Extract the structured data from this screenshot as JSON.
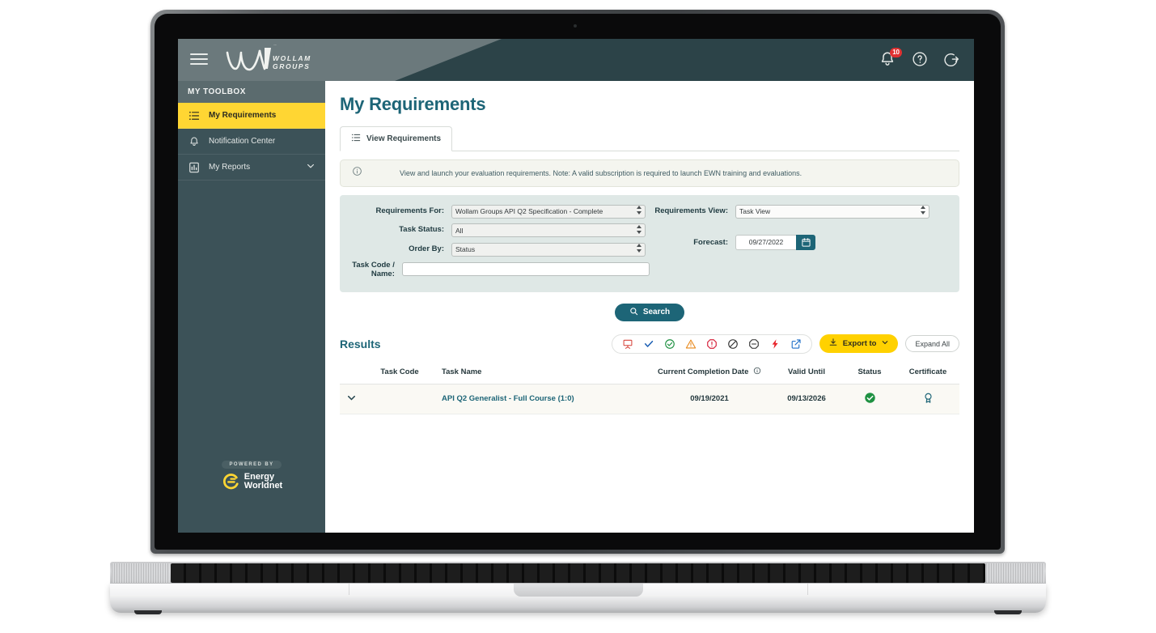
{
  "header": {
    "menu_icon": "hamburger-menu-icon",
    "brand_name": "WOLLAM",
    "brand_sub": "GROUPS",
    "notification_count": "10",
    "notification_icon": "bell-icon",
    "help_icon": "question-circle-icon",
    "logout_icon": "logout-icon"
  },
  "sidebar": {
    "section_title": "MY TOOLBOX",
    "items": [
      {
        "label": "My Requirements",
        "icon": "list-icon",
        "active": true,
        "expandable": false
      },
      {
        "label": "Notification Center",
        "icon": "bell-icon",
        "active": false,
        "expandable": false
      },
      {
        "label": "My Reports",
        "icon": "report-chart-icon",
        "active": false,
        "expandable": true
      }
    ],
    "powered_by": "POWERED BY",
    "vendor_line1": "Energy",
    "vendor_line2": "Worldnet"
  },
  "page": {
    "title": "My Requirements",
    "tab_label": "View Requirements",
    "tab_icon": "list-icon",
    "note_icon": "info-circle-icon",
    "note_text": "View and launch your evaluation requirements. Note: A valid subscription is required to launch EWN training and evaluations."
  },
  "filters": {
    "requirements_for_label": "Requirements For:",
    "requirements_for_value": "Wollam Groups API Q2 Specification - Complete",
    "task_status_label": "Task Status:",
    "task_status_value": "All",
    "order_by_label": "Order By:",
    "order_by_value": "Status",
    "task_code_label": "Task Code / Name:",
    "task_code_value": "",
    "task_code_placeholder": "",
    "requirements_view_label": "Requirements View:",
    "requirements_view_value": "Task View",
    "forecast_label": "Forecast:",
    "forecast_value": "09/27/2022",
    "calendar_icon": "calendar-icon",
    "search_label": "Search",
    "search_icon": "search-icon"
  },
  "results": {
    "title": "Results",
    "legend_icons": [
      {
        "name": "classroom-projector-icon",
        "color": "#d6453c"
      },
      {
        "name": "check-icon",
        "color": "#1c5fb4"
      },
      {
        "name": "check-circle-icon",
        "color": "#1f9142"
      },
      {
        "name": "warning-triangle-icon",
        "color": "#e8881a"
      },
      {
        "name": "exclamation-octagon-icon",
        "color": "#d6203a"
      },
      {
        "name": "no-entry-circle-icon",
        "color": "#2b2b2b"
      },
      {
        "name": "minus-octagon-icon",
        "color": "#2b2b2b"
      },
      {
        "name": "lightning-bolt-icon",
        "color": "#e8232a"
      },
      {
        "name": "external-link-icon",
        "color": "#1c6ec8"
      }
    ],
    "export_label": "Export to",
    "export_icon": "download-icon",
    "export_chevron": "chevron-down-icon",
    "expand_all_label": "Expand All",
    "columns": [
      "",
      "Task Code",
      "Task Name",
      "Current Completion Date",
      "Valid Until",
      "Status",
      "Certificate"
    ],
    "completion_info_icon": "info-circle-icon",
    "rows": [
      {
        "expand_icon": "chevron-down-icon",
        "task_code": "",
        "task_name": "API Q2 Generalist - Full Course (1:0)",
        "current_completion_date": "09/19/2021",
        "valid_until": "09/13/2026",
        "status_icon": "check-circle-filled-icon",
        "status_color": "#1f9142",
        "certificate_icon": "award-ribbon-icon",
        "certificate_color": "#1d6577"
      }
    ]
  },
  "colors": {
    "brand_teal": "#1d6577",
    "header_dark": "#2c4348",
    "header_light": "#6b797c",
    "sidebar": "#3c5258",
    "active_yellow": "#ffd633",
    "export_yellow": "#ffd100"
  }
}
